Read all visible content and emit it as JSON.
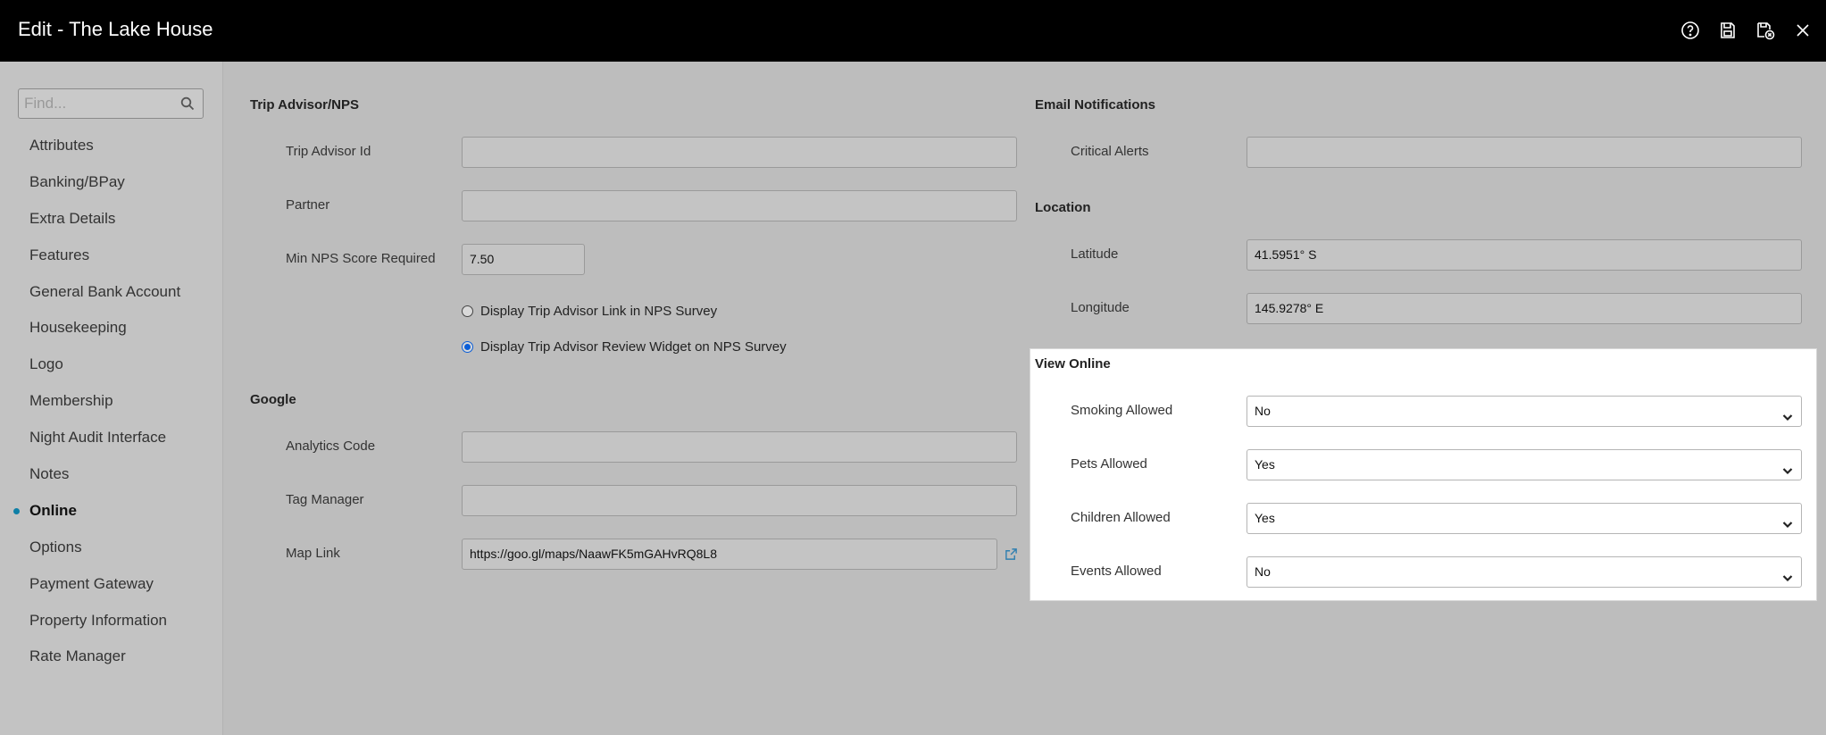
{
  "window": {
    "title": "Edit - The Lake House"
  },
  "toolbar": {
    "icons": [
      "help-icon",
      "save-icon",
      "save-and-close-icon",
      "close-icon"
    ]
  },
  "sidebar": {
    "search_placeholder": "Find...",
    "items": [
      {
        "label": "Attributes"
      },
      {
        "label": "Banking/BPay"
      },
      {
        "label": "Extra Details"
      },
      {
        "label": "Features"
      },
      {
        "label": "General Bank Account"
      },
      {
        "label": "Housekeeping"
      },
      {
        "label": "Logo"
      },
      {
        "label": "Membership"
      },
      {
        "label": "Night Audit Interface"
      },
      {
        "label": "Notes"
      },
      {
        "label": "Online",
        "active": true
      },
      {
        "label": "Options"
      },
      {
        "label": "Payment Gateway"
      },
      {
        "label": "Property Information"
      },
      {
        "label": "Rate Manager"
      }
    ]
  },
  "trip_advisor": {
    "title": "Trip Advisor/NPS",
    "trip_advisor_id": {
      "label": "Trip Advisor Id",
      "value": ""
    },
    "partner": {
      "label": "Partner",
      "value": ""
    },
    "min_nps": {
      "label": "Min NPS Score Required",
      "value": "7.50"
    },
    "options": [
      {
        "label": "Display Trip Advisor Link in NPS Survey",
        "checked": false
      },
      {
        "label": "Display Trip Advisor Review Widget on NPS Survey",
        "checked": true
      }
    ]
  },
  "google": {
    "title": "Google",
    "analytics_code": {
      "label": "Analytics Code",
      "value": ""
    },
    "tag_manager": {
      "label": "Tag Manager",
      "value": ""
    },
    "map_link": {
      "label": "Map Link",
      "value": "https://goo.gl/maps/NaawFK5mGAHvRQ8L8"
    }
  },
  "email_notifications": {
    "title": "Email Notifications",
    "critical_alerts": {
      "label": "Critical Alerts",
      "value": ""
    }
  },
  "location": {
    "title": "Location",
    "latitude": {
      "label": "Latitude",
      "value": "41.5951° S"
    },
    "longitude": {
      "label": "Longitude",
      "value": "145.9278° E"
    }
  },
  "view_online": {
    "title": "View Online",
    "smoking": {
      "label": "Smoking Allowed",
      "value": "No"
    },
    "pets": {
      "label": "Pets Allowed",
      "value": "Yes"
    },
    "children": {
      "label": "Children Allowed",
      "value": "Yes"
    },
    "events": {
      "label": "Events Allowed",
      "value": "No"
    }
  },
  "colors": {
    "topbar": "#000000",
    "background": "#bdbdbd",
    "sidebar": "#c3c3c3",
    "panel": "#ffffff",
    "active_dot": "#0e7fa6",
    "radio_selected": "#0b5ed7",
    "link_icon": "#2f7fb0"
  }
}
